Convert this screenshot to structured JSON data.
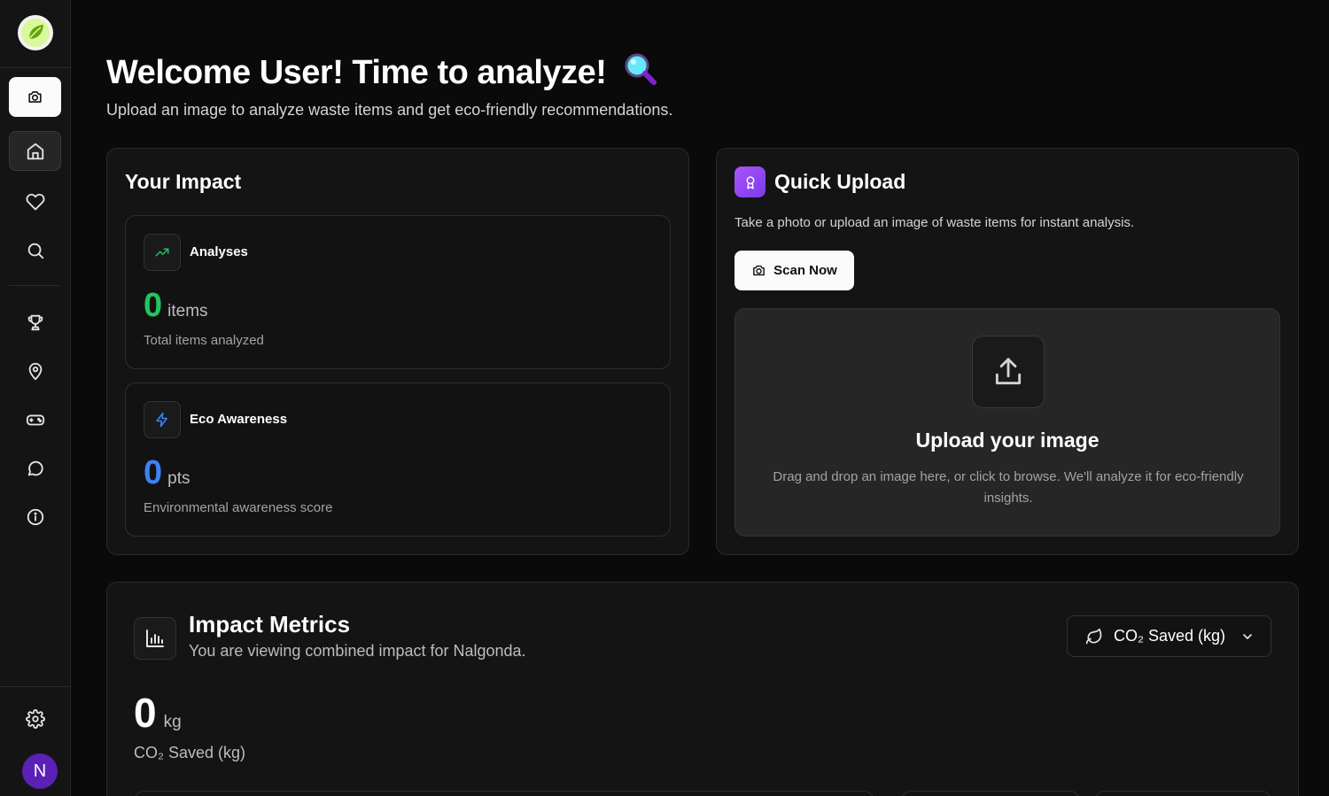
{
  "sidebar": {
    "items": [
      {
        "name": "scan-nav-button",
        "icon": "camera-icon"
      },
      {
        "name": "home-nav-button",
        "icon": "home-icon"
      },
      {
        "name": "favorites-nav-button",
        "icon": "heart-icon"
      },
      {
        "name": "search-nav-button",
        "icon": "search-icon"
      },
      {
        "name": "achievements-nav-button",
        "icon": "trophy-icon"
      },
      {
        "name": "locations-nav-button",
        "icon": "map-pin-icon"
      },
      {
        "name": "games-nav-button",
        "icon": "gamepad-icon"
      },
      {
        "name": "chat-nav-button",
        "icon": "chat-icon"
      },
      {
        "name": "info-nav-button",
        "icon": "info-icon"
      },
      {
        "name": "settings-nav-button",
        "icon": "gear-icon"
      }
    ],
    "avatar_initial": "N"
  },
  "header": {
    "title": "Welcome User! Time to analyze!",
    "subtitle": "Upload an image to analyze waste items and get eco-friendly recommendations."
  },
  "impact": {
    "title": "Your Impact",
    "analyses": {
      "label": "Analyses",
      "value": "0",
      "unit": "items",
      "description": "Total items analyzed",
      "color": "#22c55e"
    },
    "awareness": {
      "label": "Eco Awareness",
      "value": "0",
      "unit": "pts",
      "description": "Environmental awareness score",
      "color": "#3b82f6"
    }
  },
  "quick_upload": {
    "title": "Quick Upload",
    "description": "Take a photo or upload an image of waste items for instant analysis.",
    "scan_button": "Scan Now",
    "drop_title": "Upload your image",
    "drop_description": "Drag and drop an image here, or click to browse. We'll analyze it for eco-friendly insights."
  },
  "metrics": {
    "title": "Impact Metrics",
    "subtitle": "You are viewing combined impact for Nalgonda.",
    "selector": "CO₂ Saved (kg)",
    "value": "0",
    "unit": "kg",
    "description": "CO₂ Saved (kg)"
  },
  "colors": {
    "accent_purple": "#a855f7",
    "green": "#22c55e",
    "blue": "#3b82f6"
  }
}
